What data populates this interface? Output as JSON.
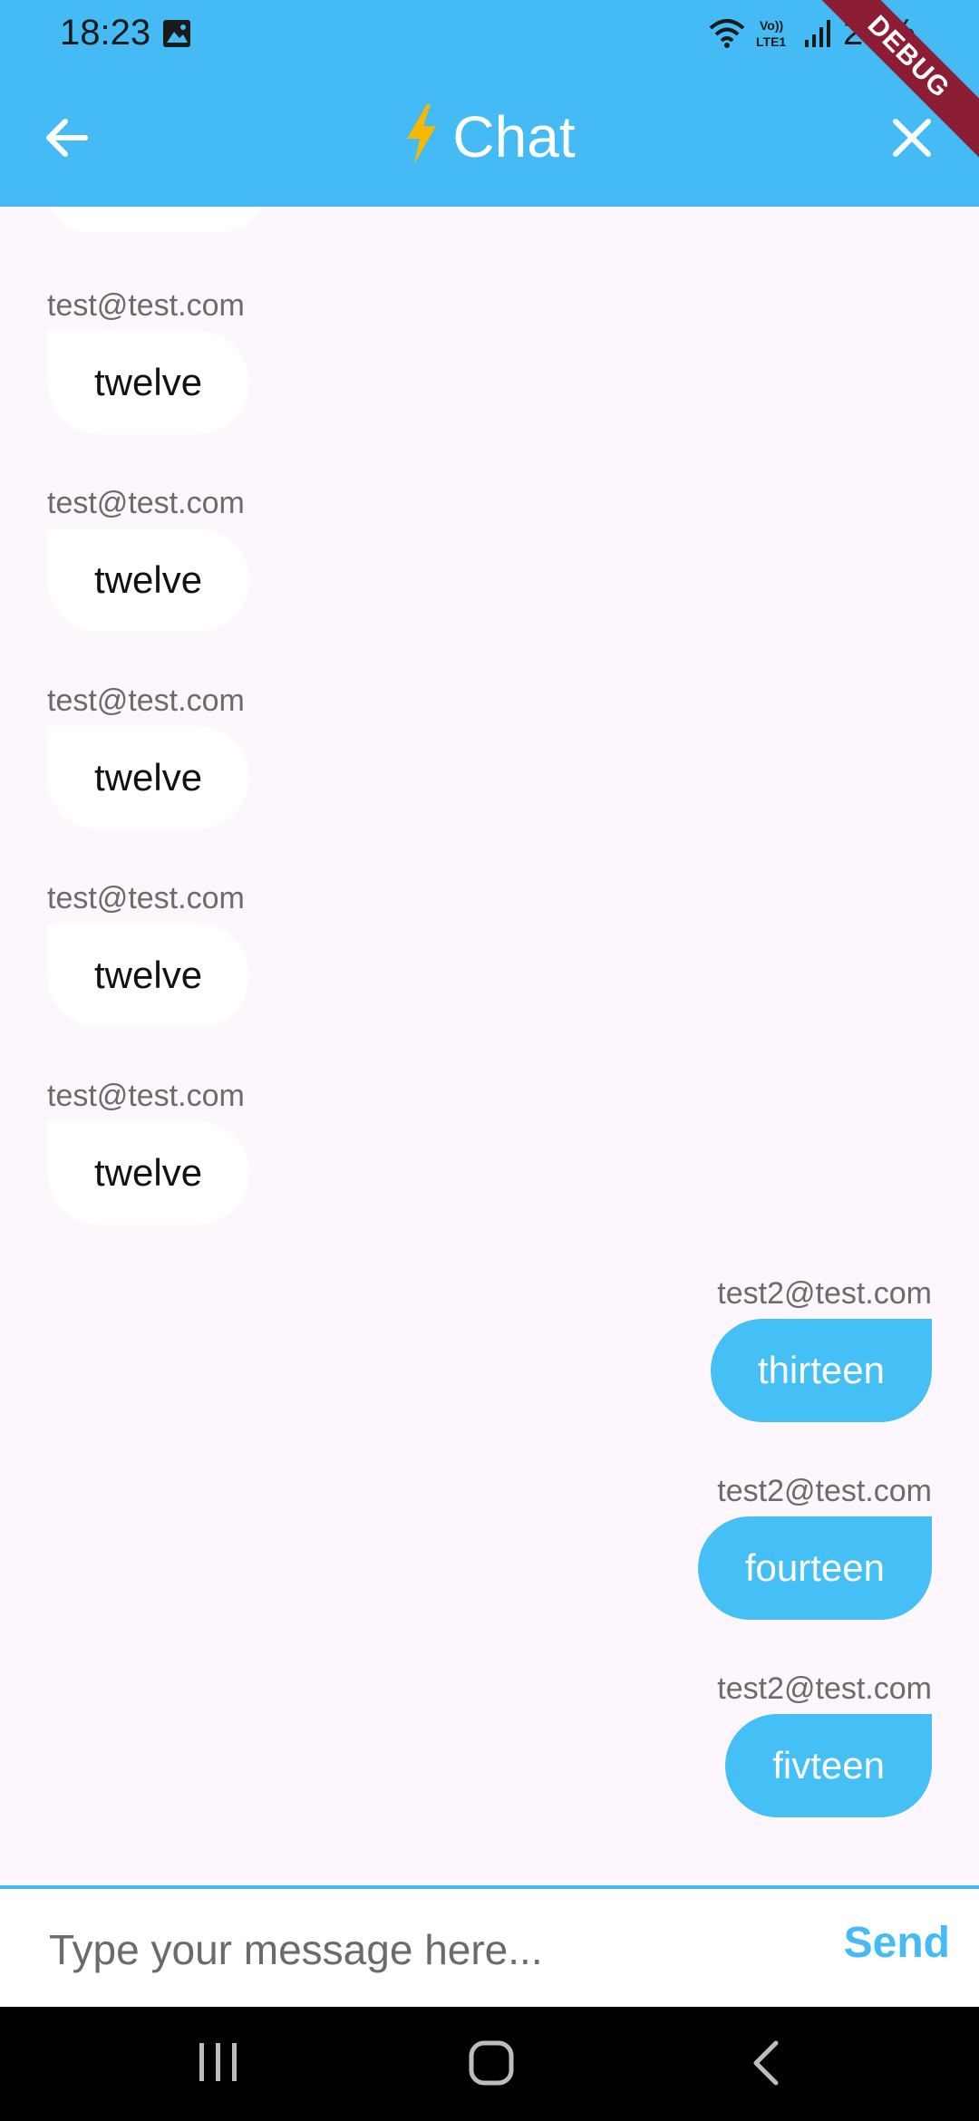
{
  "status_bar": {
    "time": "18:23",
    "battery": "24%"
  },
  "app_bar": {
    "title": "Chat",
    "back_icon": "arrow-left-icon",
    "close_icon": "close-icon"
  },
  "debug_banner": "DEBUG",
  "messages": [
    {
      "sender": "test@test.com",
      "text": "twelve",
      "direction": "incoming"
    },
    {
      "sender": "test@test.com",
      "text": "twelve",
      "direction": "incoming"
    },
    {
      "sender": "test@test.com",
      "text": "twelve",
      "direction": "incoming"
    },
    {
      "sender": "test@test.com",
      "text": "twelve",
      "direction": "incoming"
    },
    {
      "sender": "test@test.com",
      "text": "twelve",
      "direction": "incoming"
    },
    {
      "sender": "test2@test.com",
      "text": "thirteen",
      "direction": "outgoing"
    },
    {
      "sender": "test2@test.com",
      "text": "fourteen",
      "direction": "outgoing"
    },
    {
      "sender": "test2@test.com",
      "text": "fivteen",
      "direction": "outgoing"
    }
  ],
  "composer": {
    "placeholder": "Type your message here...",
    "send_label": "Send"
  },
  "colors": {
    "accent": "#44bbf5",
    "background": "#fdf6fd",
    "incoming_bubble": "#ffffff",
    "outgoing_bubble": "#44c0f7"
  }
}
